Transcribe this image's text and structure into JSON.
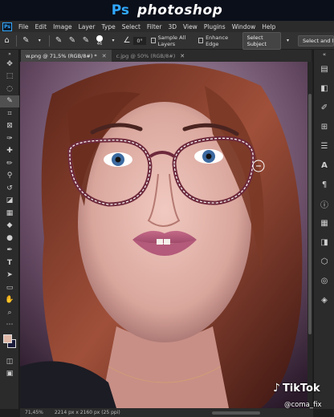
{
  "banner": {
    "ps": "Ps",
    "word": "photoshop"
  },
  "menubar": {
    "logo": "Ps",
    "items": [
      "File",
      "Edit",
      "Image",
      "Layer",
      "Type",
      "Select",
      "Filter",
      "3D",
      "View",
      "Plugins",
      "Window",
      "Help"
    ]
  },
  "optbar": {
    "brush_size": "46",
    "angle": "0°",
    "sample_all_layers": "Sample All Layers",
    "enhance_edge": "Enhance Edge",
    "select_subject": "Select Subject",
    "select_and_mask": "Select and M"
  },
  "tabs": [
    {
      "label": "w.png @ 71,5% (RGB/8#) *",
      "active": true
    },
    {
      "label": "c.jpg @ 50% (RGB/8#)",
      "active": false
    }
  ],
  "status": {
    "zoom": "71,45%",
    "doc": "2214 px x 2160 px (25 ppi)"
  },
  "watermark": {
    "brand": "TikTok",
    "handle": "@coma_fix"
  },
  "colors": {
    "accent": "#31a8ff",
    "foreground_swatch": "#e0b8a8",
    "background_swatch": "#1a1a3a"
  }
}
